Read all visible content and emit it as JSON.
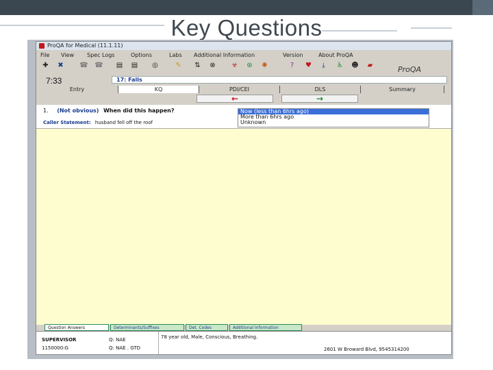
{
  "slide": {
    "title": "Key Questions"
  },
  "window": {
    "title": "ProQA for Medical (11.1.11)"
  },
  "menu": [
    "File",
    "View",
    "Spec Logs",
    "Options",
    "Labs",
    "Additional Information",
    "Version",
    "About ProQA"
  ],
  "toolbar": {
    "buttons": [
      {
        "name": "add-icon",
        "glyph": "✚",
        "color": "#222"
      },
      {
        "name": "cancel-icon",
        "glyph": "✖",
        "color": "#1a3c8c"
      },
      {
        "name": "phone-icon",
        "glyph": "☎",
        "color": "#777"
      },
      {
        "name": "phone-alt-icon",
        "glyph": "☎",
        "color": "#777"
      },
      {
        "name": "document-icon",
        "glyph": "▤",
        "color": "#222"
      },
      {
        "name": "document-alt-icon",
        "glyph": "▤",
        "color": "#222"
      },
      {
        "name": "target-icon",
        "glyph": "◎",
        "color": "#222"
      },
      {
        "name": "bulb-icon",
        "glyph": "✎",
        "color": "#c8a010"
      },
      {
        "name": "swap-icon",
        "glyph": "⇅",
        "color": "#222"
      },
      {
        "name": "stop-icon",
        "glyph": "⊗",
        "color": "#222"
      },
      {
        "name": "hazard-icon",
        "glyph": "☣",
        "color": "#c4161c"
      },
      {
        "name": "globe-icon",
        "glyph": "⊛",
        "color": "#1c8c3a"
      },
      {
        "name": "fire-icon",
        "glyph": "✺",
        "color": "#c85a10"
      },
      {
        "name": "help-icon",
        "glyph": "?",
        "color": "#8c2a8c"
      },
      {
        "name": "heart-icon",
        "glyph": "♥",
        "color": "#c4161c"
      },
      {
        "name": "download-icon",
        "glyph": "⤓",
        "color": "#1a3c8c"
      },
      {
        "name": "person-icon",
        "glyph": "♿",
        "color": "#1c8c3a"
      },
      {
        "name": "smiley-icon",
        "glyph": "☻",
        "color": "#222"
      },
      {
        "name": "car-icon",
        "glyph": "▰",
        "color": "#c4161c"
      }
    ]
  },
  "logo": {
    "text": "ProQA"
  },
  "timer": "7:33",
  "protocol": "17: Falls",
  "tabs": [
    {
      "label": "Entry",
      "active": false
    },
    {
      "label": "KQ",
      "active": true
    },
    {
      "label": "PDI/CEI",
      "active": false
    },
    {
      "label": "DLS",
      "active": false
    },
    {
      "label": "Summary",
      "active": false
    }
  ],
  "nav": {
    "back_glyph": "←",
    "back_color": "#c4161c",
    "forward_glyph": "→",
    "forward_color": "#1c8c3a"
  },
  "question": {
    "number": "1.",
    "qualifier": "(Not obvious)",
    "text": "When did this happen?",
    "caller_label": "Caller Statement:",
    "caller_text": "husband fell off the roof"
  },
  "answers": [
    {
      "text": "Now (less than 6hrs ago)",
      "selected": true
    },
    {
      "text": "More than 6hrs ago",
      "selected": false
    },
    {
      "text": "Unknown",
      "selected": false
    }
  ],
  "bottom_tabs": [
    "Question Answers",
    "Determinants/Suffixes",
    "Det. Codes",
    "Additional Information"
  ],
  "status": {
    "user": "SUPERVISOR",
    "case": "1150000:G",
    "q1": "Q: NAE",
    "q2": "Q: NAE . GTD",
    "summary": "78 year old, Male, Conscious, Breathing.",
    "address": "2601 W Broward Blvd, 9545314200"
  }
}
